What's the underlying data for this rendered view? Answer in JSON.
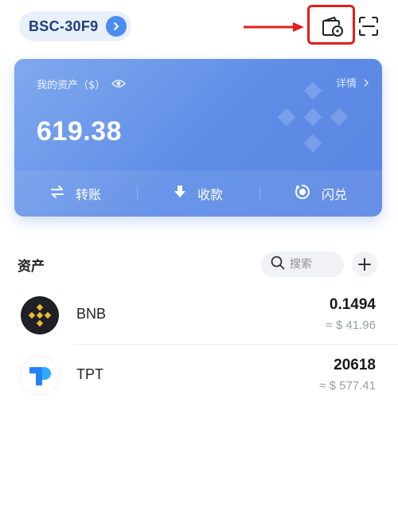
{
  "header": {
    "network": "BSC-30F9"
  },
  "card": {
    "title": "我的资产（$）",
    "details": "详情",
    "total": "619.38",
    "actions": [
      {
        "label": "转账",
        "icon": "swap-arrows-icon"
      },
      {
        "label": "收款",
        "icon": "arrow-down-icon"
      },
      {
        "label": "闪兑",
        "icon": "flash-swap-icon"
      }
    ]
  },
  "assets": {
    "heading": "资产",
    "search_placeholder": "搜索",
    "tokens": [
      {
        "symbol": "BNB",
        "amount": "0.1494",
        "value": "≈ $ 41.96",
        "logo_color": "#1e2026",
        "logo_accent": "#f3ba2f"
      },
      {
        "symbol": "TPT",
        "amount": "20618",
        "value": "≈ $ 577.41",
        "logo_color": "#ffffff",
        "logo_accent": "#2980fe"
      }
    ]
  },
  "colors": {
    "accent": "#4a8df0",
    "annotation": "#e01e1e"
  }
}
